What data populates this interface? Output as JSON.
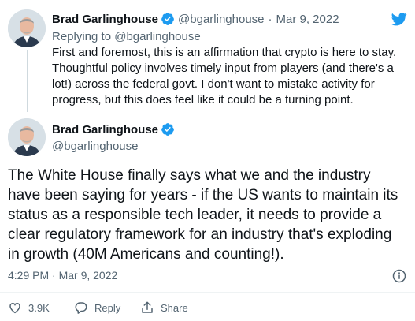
{
  "reply_tweet": {
    "name": "Brad Garlinghouse",
    "handle": "@bgarlinghouse",
    "separator": "·",
    "date": "Mar 9, 2022",
    "replying_prefix": "Replying to",
    "replying_to": "@bgarlinghouse",
    "text": "First and foremost, this is an affirmation that crypto is here to stay. Thoughtful policy involves timely input from players (and there's a lot!) across the federal govt. I don't want to mistake activity for progress, but this does feel like it could be a turning point."
  },
  "main_tweet": {
    "name": "Brad Garlinghouse",
    "handle": "@bgarlinghouse",
    "text": "The White House finally says what we and the industry have been saying for years - if the US wants to maintain its status as a responsible tech leader, it needs to provide a clear regulatory framework for an industry that's exploding in growth (40M Americans and counting!).",
    "timestamp": "4:29 PM · Mar 9, 2022",
    "actions": {
      "likes": "3.9K",
      "reply_label": "Reply",
      "share_label": "Share"
    }
  },
  "colors": {
    "brand": "#1d9bf0",
    "text": "#0f1419",
    "muted": "#536471"
  },
  "icons": [
    "twitter-bird-icon",
    "verified-badge-icon",
    "info-icon",
    "heart-icon",
    "reply-icon",
    "share-icon"
  ]
}
